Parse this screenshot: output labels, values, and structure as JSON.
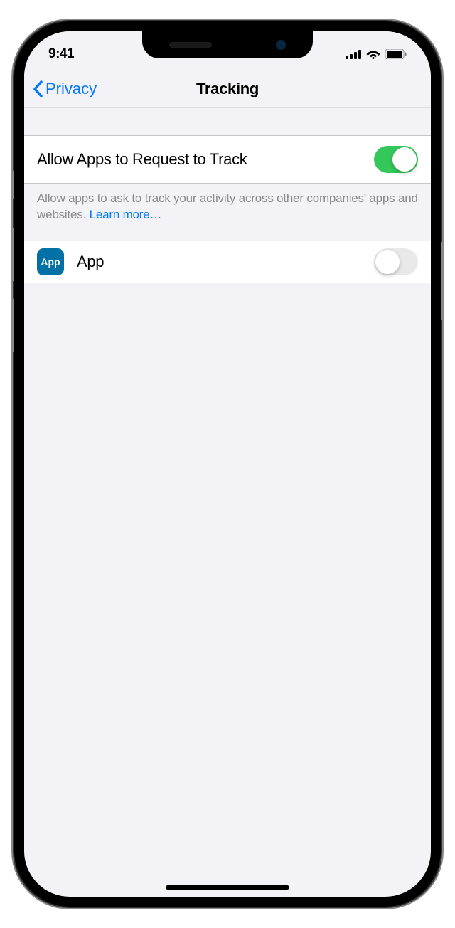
{
  "status": {
    "time": "9:41"
  },
  "nav": {
    "back_label": "Privacy",
    "title": "Tracking"
  },
  "settings": {
    "allow_request_label": "Allow Apps to Request to Track",
    "allow_request_on": true,
    "footer_text": "Allow apps to ask to track your activity across other companies' apps and websites. ",
    "learn_more_label": "Learn more…"
  },
  "apps": [
    {
      "icon_label": "App",
      "name": "App",
      "tracking_on": false
    }
  ]
}
